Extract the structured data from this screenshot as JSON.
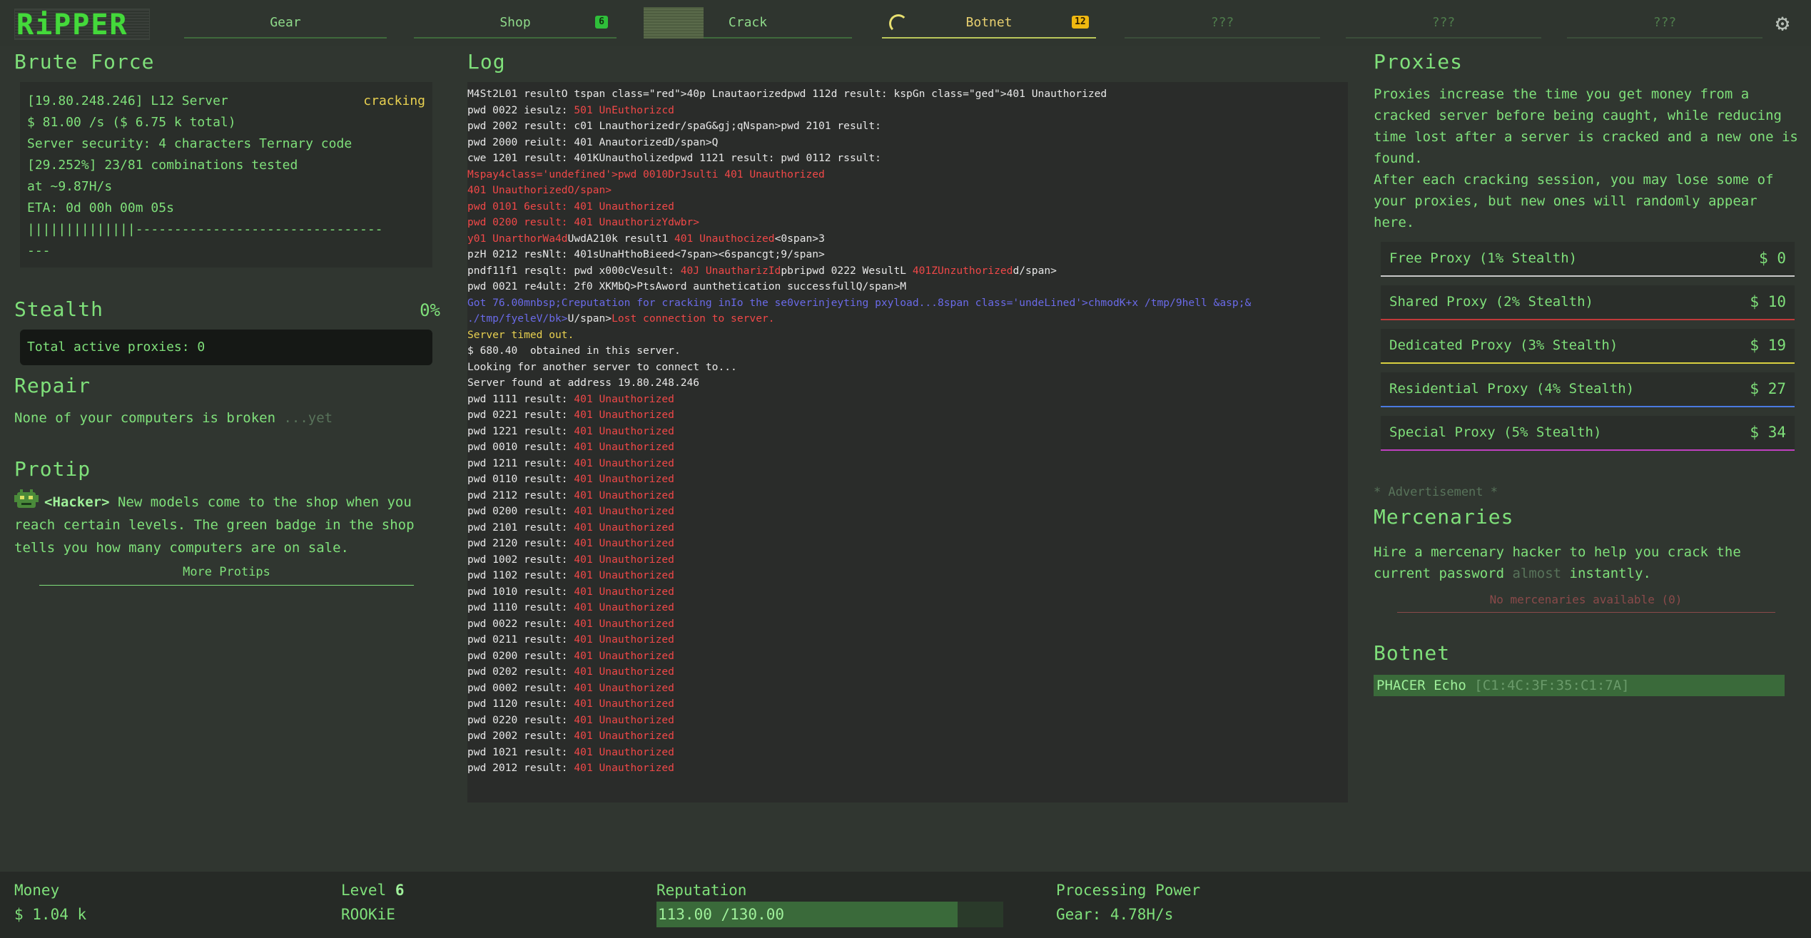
{
  "logo": {
    "text": "RiPPER"
  },
  "nav": {
    "tabs": [
      {
        "label": "Gear",
        "badge": ""
      },
      {
        "label": "Shop",
        "badge": "6"
      },
      {
        "label": "Crack",
        "badge": ""
      },
      {
        "label": "Botnet",
        "badge": "12"
      },
      {
        "label": "???",
        "badge": ""
      },
      {
        "label": "???",
        "badge": ""
      },
      {
        "label": "???",
        "badge": ""
      }
    ],
    "active_tab": "Botnet",
    "settings_icon": "gear-icon"
  },
  "brute_force": {
    "title": "Brute Force",
    "status": "cracking",
    "lines": [
      "[19.80.248.246] L12 Server",
      "$ 81.00 /s ($ 6.75 k total)",
      "Server security: 4 characters Ternary code",
      "[29.252%] 23/81 combinations tested",
      "at ~9.87H/s",
      "ETA: 0d 00h 00m 05s",
      "||||||||||||||--------------------------------",
      "---"
    ]
  },
  "stealth": {
    "title": "Stealth",
    "percent": "0%",
    "total_proxies": "Total active proxies: 0"
  },
  "repair": {
    "title": "Repair",
    "text": "None of your computers is broken",
    "muted": " ...yet"
  },
  "protip": {
    "title": "Protip",
    "label": "<Hacker>",
    "text": " New models come to the shop when you reach certain levels. The green badge in the shop tells you how many computers are on sale.",
    "more_link": "More Protips"
  },
  "log": {
    "title": "Log",
    "lines": [
      [
        [
          "w",
          "M4St2L01 resultO tspan class=\"red\">40p Lnautaorizedpwd 112d result: kspGn class=\"ged\">401 Unauthorized"
        ]
      ],
      [
        [
          "w",
          "pwd 0022 iesulz: "
        ],
        [
          "r",
          "501 UnEuthorizcd"
        ]
      ],
      [
        [
          "w",
          "pwd 2002 result: c01 Lnauthorizedr/spaG&gj;qNspan>pwd 2101 result:"
        ]
      ],
      [
        [
          "w",
          "pwd 2000 reiult: 401 AnautorizedD/span>Q"
        ]
      ],
      [
        [
          "w",
          "cwe 1201 result: 401KUnautholizedpwd 1121 result: pwd 0112 rssult:"
        ]
      ],
      [
        [
          "r",
          "Mspay4class='undefined'>pwd 0010DrJsulti 401 Unauthorized"
        ]
      ],
      [
        [
          "r",
          "401 UnauthorizedO/span>"
        ]
      ],
      [
        [
          "r",
          "pwd 0101 6esult: 401 Unauthorized"
        ]
      ],
      [
        [
          "r",
          "pwd 0200 result: 401 UnauthorizYdwbr>"
        ]
      ],
      [
        [
          "r",
          "y01 UnarthorWa4d"
        ],
        [
          "w",
          "UwdA210k result1 "
        ],
        [
          "r",
          "401 Unauthocized"
        ],
        [
          "w",
          "<0span>3"
        ]
      ],
      [
        [
          "w",
          "pzH 0212 resNlt: 401sUnaHthoBieed<7span><6spancgt;9/span>"
        ]
      ],
      [
        [
          "w",
          "pndf11f1 resqlt: pwd x000cVesult: "
        ],
        [
          "r",
          "40J UnautharizId"
        ],
        [
          "w",
          "pbripwd 0222 WesultL "
        ],
        [
          "r",
          "401ZUnzuthorized"
        ],
        [
          "w",
          "d/span>"
        ]
      ],
      [
        [
          "w",
          "pwd 0021 re4ult: 2f0 XKMbQ>PtsAword aunthetication successfullQ/span>M"
        ]
      ],
      [
        [
          "b",
          "Got 76.00mnbsp;Creputation for cracking inIo the se0verinjeyting pxyload...8span class='undeLined'>chmodK+x /tmp/9hell &asp;&"
        ]
      ],
      [
        [
          "b",
          "./tmp/fyeleV/bk>"
        ],
        [
          "w",
          "U/span>"
        ],
        [
          "r",
          "Lost connection to server."
        ]
      ],
      [
        [
          "y",
          "Server timed out."
        ]
      ],
      [
        [
          "w",
          "$ 680.40  obtained in this server."
        ]
      ],
      [
        [
          "w",
          "Looking for another server to connect to..."
        ]
      ],
      [
        [
          "w",
          "Server found at address 19.80.248.246"
        ]
      ],
      [
        [
          "w",
          "pwd 1111 result: "
        ],
        [
          "r",
          "401 Unauthorized"
        ]
      ],
      [
        [
          "w",
          "pwd 0221 result: "
        ],
        [
          "r",
          "401 Unauthorized"
        ]
      ],
      [
        [
          "w",
          "pwd 1221 result: "
        ],
        [
          "r",
          "401 Unauthorized"
        ]
      ],
      [
        [
          "w",
          "pwd 0010 result: "
        ],
        [
          "r",
          "401 Unauthorized"
        ]
      ],
      [
        [
          "w",
          "pwd 1211 result: "
        ],
        [
          "r",
          "401 Unauthorized"
        ]
      ],
      [
        [
          "w",
          "pwd 0110 result: "
        ],
        [
          "r",
          "401 Unauthorized"
        ]
      ],
      [
        [
          "w",
          "pwd 2112 result: "
        ],
        [
          "r",
          "401 Unauthorized"
        ]
      ],
      [
        [
          "w",
          "pwd 0200 result: "
        ],
        [
          "r",
          "401 Unauthorized"
        ]
      ],
      [
        [
          "w",
          "pwd 2101 result: "
        ],
        [
          "r",
          "401 Unauthorized"
        ]
      ],
      [
        [
          "w",
          "pwd 2120 result: "
        ],
        [
          "r",
          "401 Unauthorized"
        ]
      ],
      [
        [
          "w",
          "pwd 1002 result: "
        ],
        [
          "r",
          "401 Unauthorized"
        ]
      ],
      [
        [
          "w",
          "pwd 1102 result: "
        ],
        [
          "r",
          "401 Unauthorized"
        ]
      ],
      [
        [
          "w",
          "pwd 1010 result: "
        ],
        [
          "r",
          "401 Unauthorized"
        ]
      ],
      [
        [
          "w",
          "pwd 1110 result: "
        ],
        [
          "r",
          "401 Unauthorized"
        ]
      ],
      [
        [
          "w",
          "pwd 0022 result: "
        ],
        [
          "r",
          "401 Unauthorized"
        ]
      ],
      [
        [
          "w",
          "pwd 0211 result: "
        ],
        [
          "r",
          "401 Unauthorized"
        ]
      ],
      [
        [
          "w",
          "pwd 0200 result: "
        ],
        [
          "r",
          "401 Unauthorized"
        ]
      ],
      [
        [
          "w",
          "pwd 0202 result: "
        ],
        [
          "r",
          "401 Unauthorized"
        ]
      ],
      [
        [
          "w",
          "pwd 0002 result: "
        ],
        [
          "r",
          "401 Unauthorized"
        ]
      ],
      [
        [
          "w",
          "pwd 1120 result: "
        ],
        [
          "r",
          "401 Unauthorized"
        ]
      ],
      [
        [
          "w",
          "pwd 0220 result: "
        ],
        [
          "r",
          "401 Unauthorized"
        ]
      ],
      [
        [
          "w",
          "pwd 2002 result: "
        ],
        [
          "r",
          "401 Unauthorized"
        ]
      ],
      [
        [
          "w",
          "pwd 1021 result: "
        ],
        [
          "r",
          "401 Unauthorized"
        ]
      ],
      [
        [
          "w",
          "pwd 2012 result: "
        ],
        [
          "r",
          "401 Unauthorized"
        ]
      ]
    ]
  },
  "proxies": {
    "title": "Proxies",
    "description_1": "Proxies increase the time you get money from a cracked server before being caught, while reducing time lost after a server is cracked and a new one is found.",
    "description_2": "After each cracking session, you may lose some of your proxies, but new ones will randomly appear here.",
    "items": [
      {
        "name": "Free Proxy (1% Stealth)",
        "price": "$ 0",
        "color": "#c8c8c8"
      },
      {
        "name": "Shared Proxy (2% Stealth)",
        "price": "$ 10",
        "color": "#c03a3a"
      },
      {
        "name": "Dedicated Proxy (3% Stealth)",
        "price": "$ 19",
        "color": "#d8d040"
      },
      {
        "name": "Residential Proxy (4% Stealth)",
        "price": "$ 27",
        "color": "#4a7ae0"
      },
      {
        "name": "Special Proxy (5% Stealth)",
        "price": "$ 34",
        "color": "#c040c0"
      }
    ]
  },
  "advertisement": {
    "label": "* Advertisement *"
  },
  "mercenaries": {
    "title": "Mercenaries",
    "desc_1": "Hire a mercenary hacker to help you crack the current password ",
    "desc_muted": "almost",
    "desc_2": " instantly.",
    "none": "No mercenaries available (0)"
  },
  "botnet": {
    "title": "Botnet",
    "items": [
      {
        "name": "PHACER Echo",
        "mac": " [C1:4C:3F:35:C1:7A]"
      }
    ]
  },
  "bottom": {
    "money_label": "Money",
    "money_value": "$ 1.04 k",
    "level_label": "Level",
    "level_value": "6",
    "rank": "ROOKiE",
    "reputation_label": "Reputation",
    "reputation_text": "113.00 /130.00",
    "reputation_current": 113,
    "reputation_max": 130,
    "processing_label": "Processing Power",
    "processing_value": "Gear: 4.78H/s"
  }
}
